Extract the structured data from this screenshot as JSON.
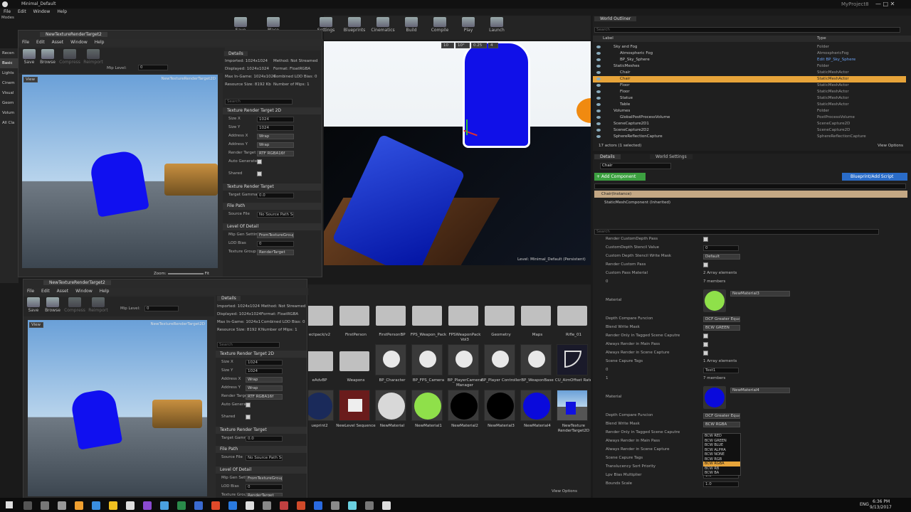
{
  "window": {
    "title": "Minimal_Default",
    "project": "MyProject8",
    "menu": [
      "File",
      "Edit",
      "Window",
      "Help"
    ],
    "modes_tab": "Modes"
  },
  "main_toolbar": [
    {
      "label": "Save",
      "icon": "save-icon"
    },
    {
      "label": "Place",
      "icon": "place-icon"
    },
    {
      "label": "Settings",
      "icon": "settings-icon"
    },
    {
      "label": "Blueprints",
      "icon": "blueprints-icon"
    },
    {
      "label": "Cinematics",
      "icon": "cinematics-icon"
    },
    {
      "label": "Build",
      "icon": "build-icon"
    },
    {
      "label": "Compile",
      "icon": "compile-icon"
    },
    {
      "label": "Play",
      "icon": "play-icon"
    },
    {
      "label": "Launch",
      "icon": "launch-icon"
    }
  ],
  "modes_list": [
    "Recen",
    "Basic",
    "Lights",
    "Cinem",
    "Visual",
    "Geom",
    "Volum",
    "All Cla"
  ],
  "viewport": {
    "status": "Level:  Minimal_Default (Persistent)",
    "snap1": "10",
    "snap2": "10°",
    "scale": "0.25",
    "cam": "4"
  },
  "te1": {
    "tab": "NewTextureRenderTarget2",
    "menu": [
      "File",
      "Edit",
      "Asset",
      "Window",
      "Help"
    ],
    "save": "Save",
    "browse": "Browse",
    "compress": "Compress",
    "reimport": "Reimport",
    "mip": "Mip Level:",
    "mip_val": "0",
    "view": "View",
    "caption": "NewTextureRenderTarget2D",
    "zoom": "Zoom:",
    "zoom_val": "Fit",
    "details_tab": "Details",
    "info": [
      "Imported: 1024x1024",
      "Method: Not Streamed",
      "Displayed: 1024x1024",
      "Format: FloatRGBA",
      "Max In-Game: 1024x1024",
      "Combined LOD Bias: 0",
      "Resource Size: 8192 Kb",
      "Number of Mips: 1"
    ],
    "search": "Search"
  },
  "te2": {
    "tab": "NewTextureRenderTarget2",
    "menu": [
      "File",
      "Edit",
      "Asset",
      "Window",
      "Help"
    ],
    "save": "Save",
    "browse": "Browse",
    "compress": "Compress",
    "reimport": "Reimport",
    "mip": "Mip Level:",
    "mip_val": "0",
    "view": "View",
    "caption": "NewTextureRenderTarget2D",
    "details_tab": "Details",
    "info": [
      "Imported: 1024x1024",
      "Method: Not Streamed",
      "Displayed: 1024x1024",
      "Format: FloatRGBA",
      "Max In-Game: 1024x1",
      "Combined LOD Bias: 0",
      "Resource Size: 8192 K",
      "Number of Mips: 1"
    ],
    "search": "Search"
  },
  "props": {
    "sec_trt": "Texture Render Target 2D",
    "size_x": "Size X",
    "size_x_v": "1024",
    "size_y": "Size Y",
    "size_y_v": "1024",
    "addr_x": "Address X",
    "addr_x_v": "Wrap",
    "addr_y": "Address Y",
    "addr_y_v": "Wrap",
    "rt_fmt": "Render Target",
    "rt_fmt_v": "RTF RGBA16f",
    "auto_gen": "Auto Generate",
    "shared": "Shared",
    "sec_tr": "Texture Render Target",
    "tgt_gamma": "Target Gamma",
    "tgt_gamma_v": "0.0",
    "sec_fp": "File Path",
    "src_file": "Source File",
    "src_file_v": "No Source Path Set",
    "sec_lod": "Level Of Detail",
    "mip_gen": "Mip Gen Settin",
    "mip_gen_v": "FromTextureGroup",
    "lod_bias": "LOD Bias",
    "lod_bias_v": "0",
    "tex_group": "Texture Group",
    "tex_group_v": "RenderTarget"
  },
  "content": {
    "view_options": "View Options",
    "assets": [
      {
        "name": "ectpack/v2",
        "kind": "folder"
      },
      {
        "name": "FirstPerson",
        "kind": "folder"
      },
      {
        "name": "FirstPersonBP",
        "kind": "folder"
      },
      {
        "name": "FPS_Weapon_Pack",
        "kind": "folder"
      },
      {
        "name": "FPSWeaponPack Vol3",
        "kind": "folder"
      },
      {
        "name": "Geometry",
        "kind": "folder"
      },
      {
        "name": "Maps",
        "kind": "folder"
      },
      {
        "name": "Rifle_01",
        "kind": "folder"
      },
      {
        "name": "eAdvBP",
        "kind": "folder"
      },
      {
        "name": "Weapons",
        "kind": "folder"
      },
      {
        "name": "BP_Character",
        "kind": "bp"
      },
      {
        "name": "BP_FPS_Camera",
        "kind": "bp"
      },
      {
        "name": "BP_PlayerCamera Manager",
        "kind": "bp"
      },
      {
        "name": "BP_Player Controller",
        "kind": "bp"
      },
      {
        "name": "BP_WeaponBase",
        "kind": "bp"
      },
      {
        "name": "CU_AimOffset Rate",
        "kind": "curve"
      },
      {
        "name": "ueprint2",
        "kind": "mat"
      },
      {
        "name": "NewLevel Sequence",
        "kind": "seq"
      },
      {
        "name": "NewMaterial",
        "kind": "mat"
      },
      {
        "name": "NewMaterial1",
        "kind": "mat"
      },
      {
        "name": "NewMaterial2",
        "kind": "mat"
      },
      {
        "name": "NewMaterial3",
        "kind": "mat"
      },
      {
        "name": "NewMaterial4",
        "kind": "mat"
      },
      {
        "name": "NewTexture RenderTarget2D",
        "kind": "tex"
      }
    ]
  },
  "outliner": {
    "tab": "World Outliner",
    "search": "Search",
    "col_label": "Label",
    "col_type": "Type",
    "rows": [
      {
        "label": "Sky and Fog",
        "type": "Folder",
        "indent": 1,
        "sel": false
      },
      {
        "label": "Atmospheric Fog",
        "type": "AtmosphericFog",
        "indent": 2,
        "sel": false
      },
      {
        "label": "BP_Sky_Sphere",
        "type": "Edit BP_Sky_Sphere",
        "indent": 2,
        "sel": false
      },
      {
        "label": "StaticMeshes",
        "type": "Folder",
        "indent": 1,
        "sel": false
      },
      {
        "label": "Chair",
        "type": "StaticMeshActor",
        "indent": 2,
        "sel": false
      },
      {
        "label": "Chair",
        "type": "StaticMeshActor",
        "indent": 2,
        "sel": true
      },
      {
        "label": "Floor",
        "type": "StaticMeshActor",
        "indent": 2,
        "sel": false
      },
      {
        "label": "Floor",
        "type": "StaticMeshActor",
        "indent": 2,
        "sel": false
      },
      {
        "label": "Statue",
        "type": "StaticMeshActor",
        "indent": 2,
        "sel": false
      },
      {
        "label": "Table",
        "type": "StaticMeshActor",
        "indent": 2,
        "sel": false
      },
      {
        "label": "Volumes",
        "type": "Folder",
        "indent": 1,
        "sel": false
      },
      {
        "label": "GlobalPostProcessVolume",
        "type": "PostProcessVolume",
        "indent": 2,
        "sel": false
      },
      {
        "label": "SceneCapture2D1",
        "type": "SceneCapture2D",
        "indent": 1,
        "sel": false
      },
      {
        "label": "SceneCapture2D2",
        "type": "SceneCapture2D",
        "indent": 1,
        "sel": false
      },
      {
        "label": "SphereReflectionCapture",
        "type": "SphereReflectionCapture",
        "indent": 1,
        "sel": false
      }
    ],
    "footer": "17 actors (1 selected)",
    "view_options": "View Options"
  },
  "details": {
    "tab": "Details",
    "tab2": "World Settings",
    "name": "Chair",
    "add_comp": "+ Add Component",
    "bp_script": "Blueprint/Add Script",
    "comp1": "Chair(Instance)",
    "comp2": "StaticMeshComponent (Inherited)",
    "search": "Search",
    "rows": [
      {
        "label": "Render CustomDepth Pass",
        "kind": "check"
      },
      {
        "label": "CustomDepth Stencil Value",
        "kind": "input",
        "value": "0"
      },
      {
        "label": "Custom Depth Stencil Write Mask",
        "kind": "drop",
        "value": "Default"
      },
      {
        "label": "Render Custom Pass",
        "kind": "check"
      },
      {
        "label": "Custom Pass Material",
        "kind": "text",
        "value": "2 Array elements"
      },
      {
        "label": "0",
        "kind": "text",
        "value": "7 members"
      },
      {
        "label": "Material",
        "kind": "mat",
        "value": "NewMaterial3",
        "color": "#8fe04a"
      },
      {
        "label": "Depth Compare Funcion",
        "kind": "drop",
        "value": "DCF Greater Equal"
      },
      {
        "label": "Blend Write Mask",
        "kind": "drop",
        "value": "BCW GREEN"
      },
      {
        "label": "Render Only in Tagged Scene Caputre",
        "kind": "check"
      },
      {
        "label": "Always Render in Main Pass",
        "kind": "check"
      },
      {
        "label": "Always Render in Scene Capture",
        "kind": "check"
      },
      {
        "label": "Scene Capure Tags",
        "kind": "text",
        "value": "1 Array elements"
      },
      {
        "label": "0",
        "kind": "input",
        "value": "Test1"
      },
      {
        "label": "1",
        "kind": "text",
        "value": "7 members"
      },
      {
        "label": "Material",
        "kind": "mat",
        "value": "NewMaterial4",
        "color": "#0a0adc"
      },
      {
        "label": "Depth Compare Funcion",
        "kind": "drop",
        "value": "DCF Greater Equal"
      },
      {
        "label": "Blend Write Mask",
        "kind": "drop",
        "value": "BCW RGBA"
      },
      {
        "label": "Render Only in Tagged Scene Caputre",
        "kind": "text",
        "value": ""
      },
      {
        "label": "Always Render in Main Pass",
        "kind": "text",
        "value": ""
      },
      {
        "label": "Always Render in Scene Capture",
        "kind": "text",
        "value": ""
      },
      {
        "label": "Scene Capure Tags",
        "kind": "text",
        "value": ""
      },
      {
        "label": "Translucency Sort Priority",
        "kind": "text",
        "value": ""
      },
      {
        "label": "Lpv Bias Multiplier",
        "kind": "input",
        "value": "1.0"
      },
      {
        "label": "Bounds Scale",
        "kind": "input",
        "value": "1.0"
      }
    ],
    "dropdown_opts": [
      "BCW RED",
      "BCW GREEN",
      "BCW BLUE",
      "BCW ALPHA",
      "BCW NONE",
      "BCW RGB",
      "BCW RGBA",
      "BCW RB",
      "BCW BA"
    ],
    "dropdown_sel": "BCW RGBA"
  },
  "taskbar": {
    "time": "6:36 PM",
    "date": "9/13/2017",
    "lang": "ENG"
  }
}
